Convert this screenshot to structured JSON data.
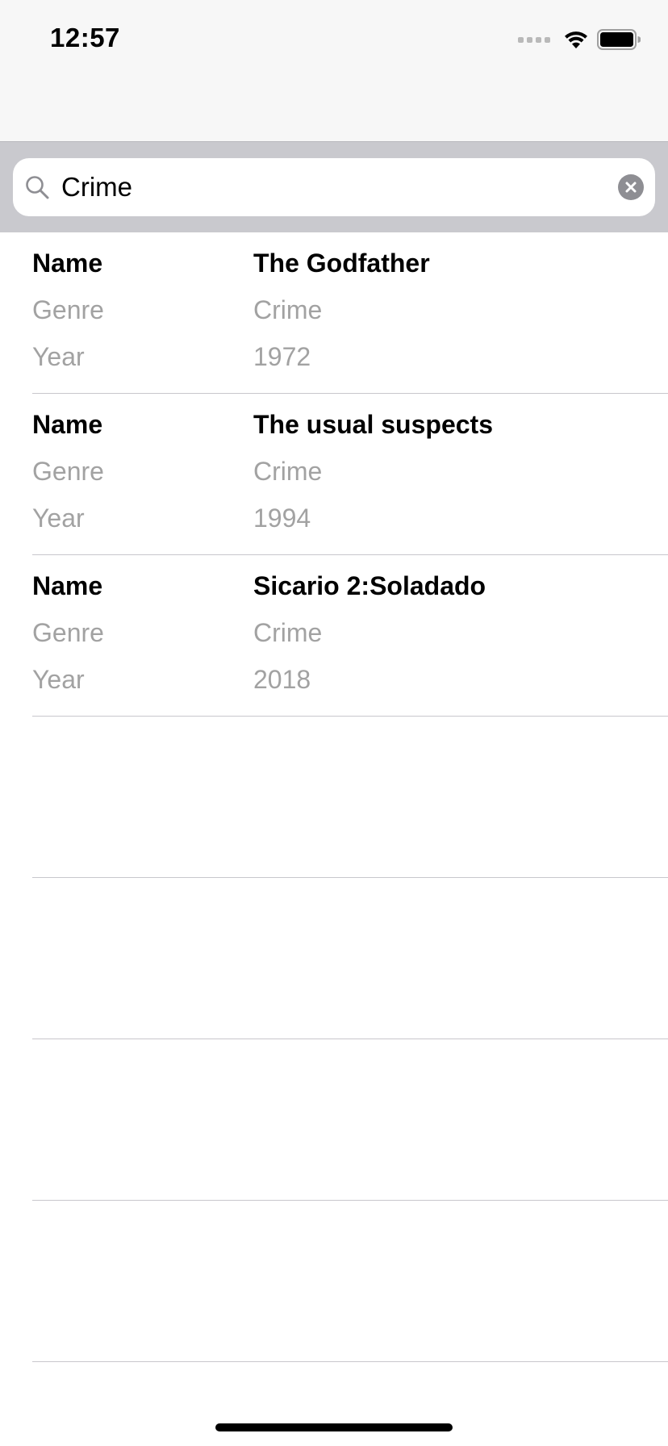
{
  "status_bar": {
    "time": "12:57"
  },
  "search": {
    "query": "Crime",
    "icon": "magnifying-glass",
    "clear_icon": "x-circle"
  },
  "movies": [
    {
      "name_label": "Name",
      "name": "The Godfather",
      "genre_label": "Genre",
      "genre": "Crime",
      "year_label": "Year",
      "year": "1972"
    },
    {
      "name_label": "Name",
      "name": "The usual suspects",
      "genre_label": "Genre",
      "genre": "Crime",
      "year_label": "Year",
      "year": "1994"
    },
    {
      "name_label": "Name",
      "name": "Sicario 2:Soladado",
      "genre_label": "Genre",
      "genre": "Crime",
      "year_label": "Year",
      "year": "2018"
    }
  ],
  "colors": {
    "nav_background": "#f7f7f7",
    "search_band": "#c9c9ce",
    "secondary_text": "#a2a2a2",
    "separator": "#c8c7cc"
  }
}
